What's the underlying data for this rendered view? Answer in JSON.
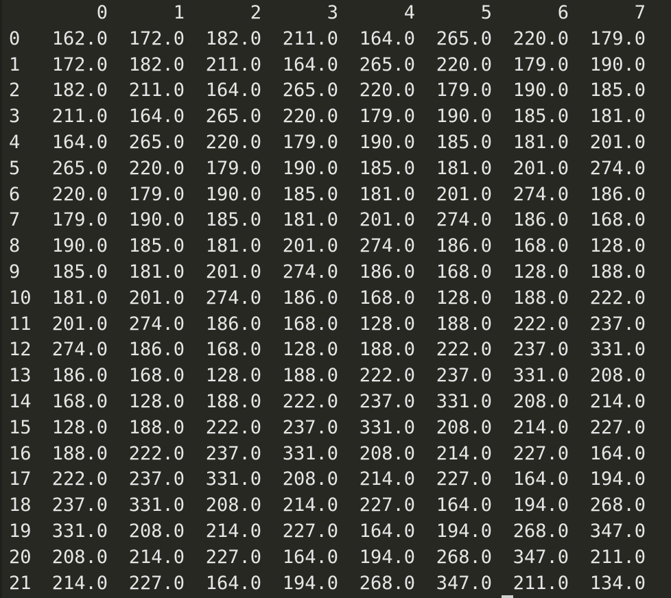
{
  "table": {
    "columns": [
      "0",
      "1",
      "2",
      "3",
      "4",
      "5",
      "6",
      "7"
    ],
    "rows": [
      {
        "index": "0",
        "values": [
          "162.0",
          "172.0",
          "182.0",
          "211.0",
          "164.0",
          "265.0",
          "220.0",
          "179.0"
        ]
      },
      {
        "index": "1",
        "values": [
          "172.0",
          "182.0",
          "211.0",
          "164.0",
          "265.0",
          "220.0",
          "179.0",
          "190.0"
        ]
      },
      {
        "index": "2",
        "values": [
          "182.0",
          "211.0",
          "164.0",
          "265.0",
          "220.0",
          "179.0",
          "190.0",
          "185.0"
        ]
      },
      {
        "index": "3",
        "values": [
          "211.0",
          "164.0",
          "265.0",
          "220.0",
          "179.0",
          "190.0",
          "185.0",
          "181.0"
        ]
      },
      {
        "index": "4",
        "values": [
          "164.0",
          "265.0",
          "220.0",
          "179.0",
          "190.0",
          "185.0",
          "181.0",
          "201.0"
        ]
      },
      {
        "index": "5",
        "values": [
          "265.0",
          "220.0",
          "179.0",
          "190.0",
          "185.0",
          "181.0",
          "201.0",
          "274.0"
        ]
      },
      {
        "index": "6",
        "values": [
          "220.0",
          "179.0",
          "190.0",
          "185.0",
          "181.0",
          "201.0",
          "274.0",
          "186.0"
        ]
      },
      {
        "index": "7",
        "values": [
          "179.0",
          "190.0",
          "185.0",
          "181.0",
          "201.0",
          "274.0",
          "186.0",
          "168.0"
        ]
      },
      {
        "index": "8",
        "values": [
          "190.0",
          "185.0",
          "181.0",
          "201.0",
          "274.0",
          "186.0",
          "168.0",
          "128.0"
        ]
      },
      {
        "index": "9",
        "values": [
          "185.0",
          "181.0",
          "201.0",
          "274.0",
          "186.0",
          "168.0",
          "128.0",
          "188.0"
        ]
      },
      {
        "index": "10",
        "values": [
          "181.0",
          "201.0",
          "274.0",
          "186.0",
          "168.0",
          "128.0",
          "188.0",
          "222.0"
        ]
      },
      {
        "index": "11",
        "values": [
          "201.0",
          "274.0",
          "186.0",
          "168.0",
          "128.0",
          "188.0",
          "222.0",
          "237.0"
        ]
      },
      {
        "index": "12",
        "values": [
          "274.0",
          "186.0",
          "168.0",
          "128.0",
          "188.0",
          "222.0",
          "237.0",
          "331.0"
        ]
      },
      {
        "index": "13",
        "values": [
          "186.0",
          "168.0",
          "128.0",
          "188.0",
          "222.0",
          "237.0",
          "331.0",
          "208.0"
        ]
      },
      {
        "index": "14",
        "values": [
          "168.0",
          "128.0",
          "188.0",
          "222.0",
          "237.0",
          "331.0",
          "208.0",
          "214.0"
        ]
      },
      {
        "index": "15",
        "values": [
          "128.0",
          "188.0",
          "222.0",
          "237.0",
          "331.0",
          "208.0",
          "214.0",
          "227.0"
        ]
      },
      {
        "index": "16",
        "values": [
          "188.0",
          "222.0",
          "237.0",
          "331.0",
          "208.0",
          "214.0",
          "227.0",
          "164.0"
        ]
      },
      {
        "index": "17",
        "values": [
          "222.0",
          "237.0",
          "331.0",
          "208.0",
          "214.0",
          "227.0",
          "164.0",
          "194.0"
        ]
      },
      {
        "index": "18",
        "values": [
          "237.0",
          "331.0",
          "208.0",
          "214.0",
          "227.0",
          "164.0",
          "194.0",
          "268.0"
        ]
      },
      {
        "index": "19",
        "values": [
          "331.0",
          "208.0",
          "214.0",
          "227.0",
          "164.0",
          "194.0",
          "268.0",
          "347.0"
        ]
      },
      {
        "index": "20",
        "values": [
          "208.0",
          "214.0",
          "227.0",
          "164.0",
          "194.0",
          "268.0",
          "347.0",
          "211.0"
        ]
      },
      {
        "index": "21",
        "values": [
          "214.0",
          "227.0",
          "164.0",
          "194.0",
          "268.0",
          "347.0",
          "211.0",
          "134.0"
        ]
      }
    ]
  },
  "colors": {
    "background": "#272822",
    "text": "#e6e6e6",
    "cursor": "#cfcfcf"
  }
}
